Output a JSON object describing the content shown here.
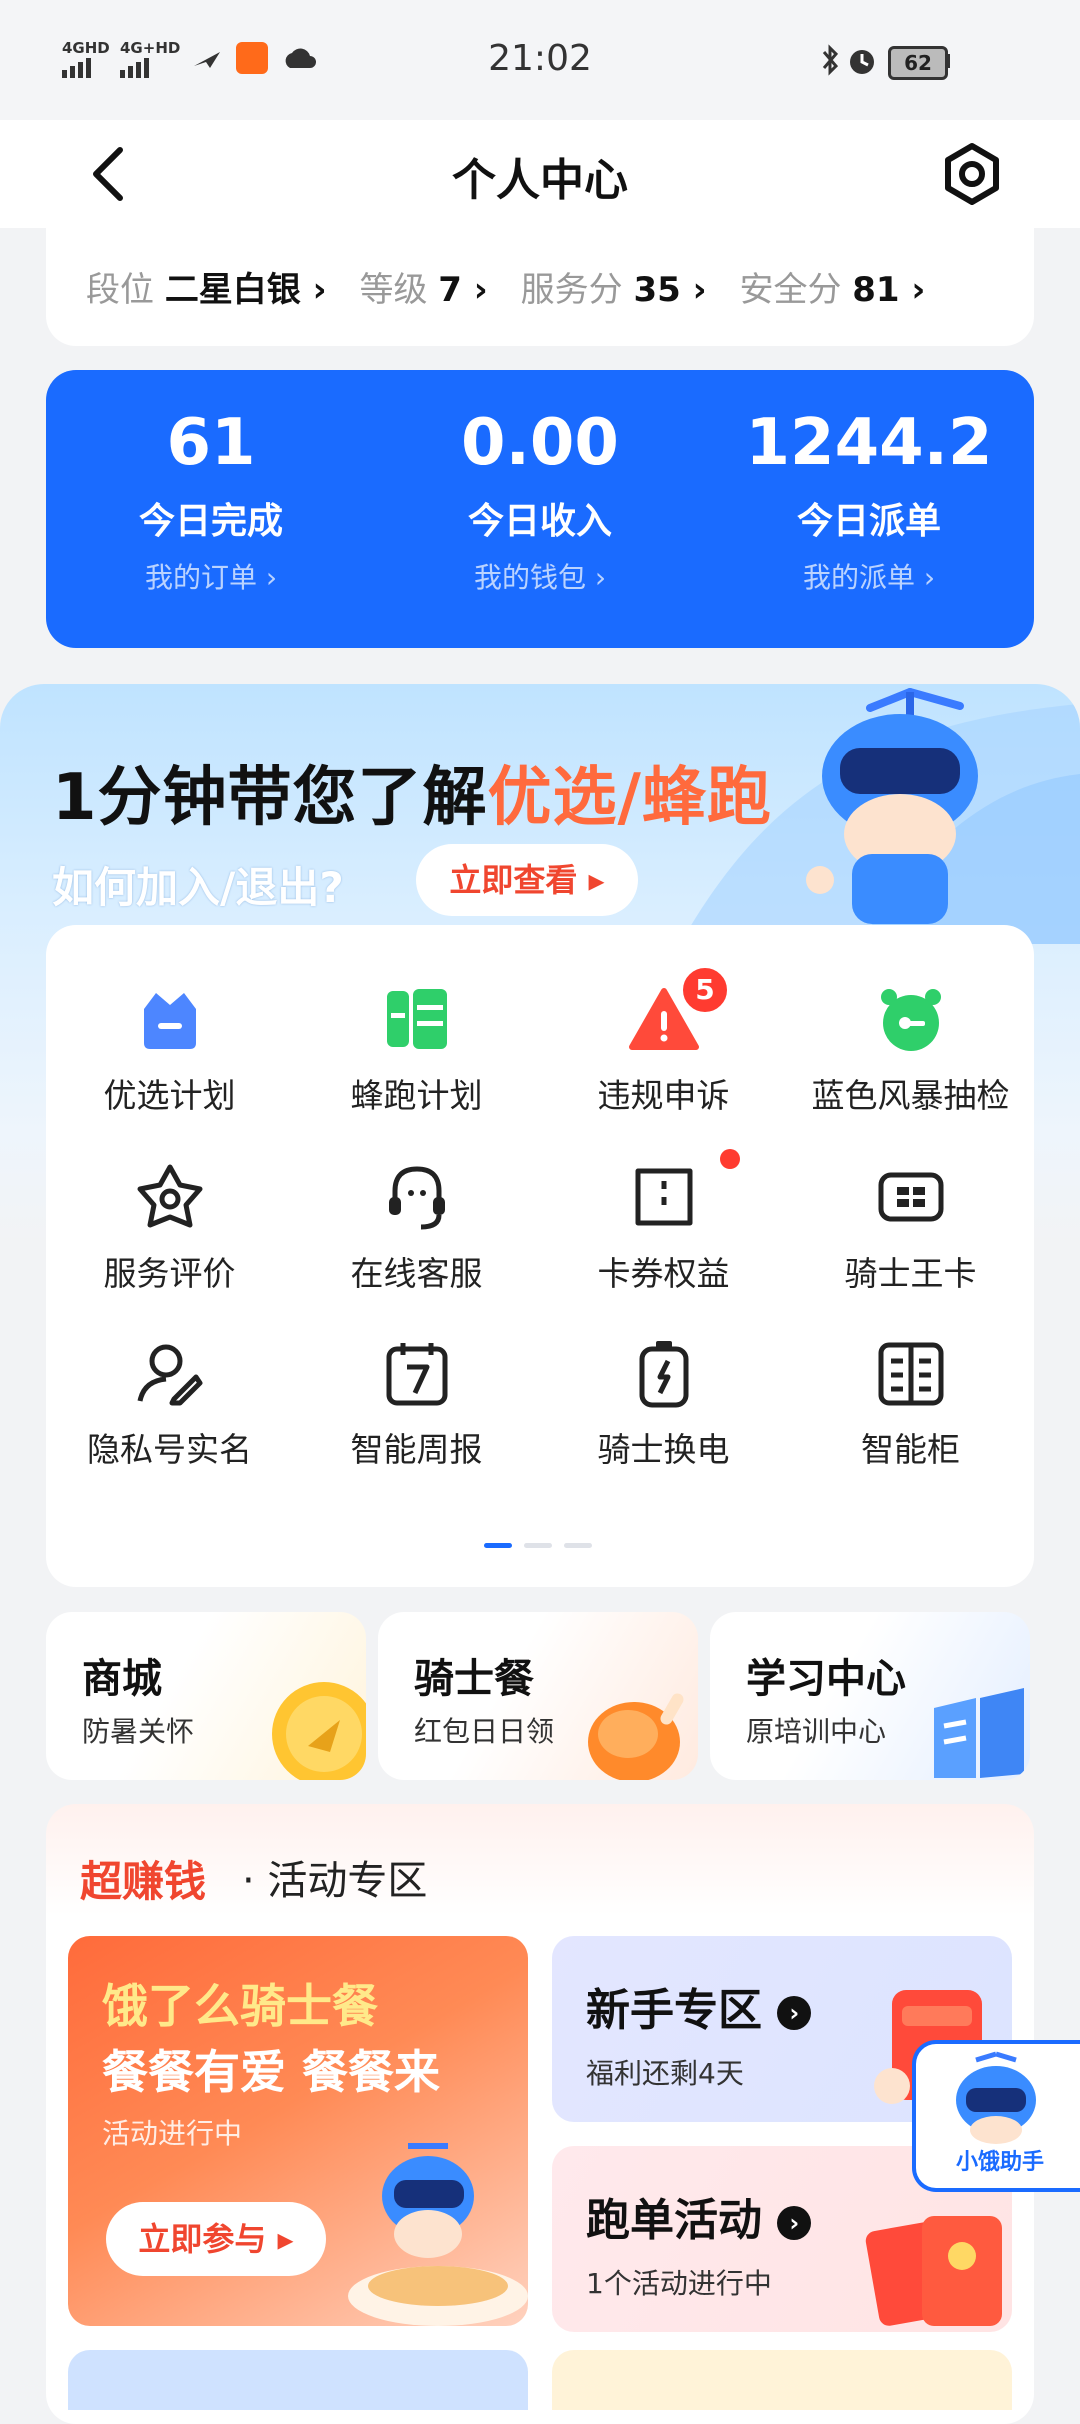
{
  "status_bar": {
    "time": "21:02",
    "signal1": "4GHD",
    "signal2": "4G+HD",
    "battery": "62"
  },
  "header": {
    "title": "个人中心"
  },
  "rank": {
    "items": [
      {
        "label": "段位",
        "value": "二星白银"
      },
      {
        "label": "等级",
        "value": "7"
      },
      {
        "label": "服务分",
        "value": "35"
      },
      {
        "label": "安全分",
        "value": "81"
      }
    ]
  },
  "stats": [
    {
      "value": "61",
      "label": "今日完成",
      "link": "我的订单 ›"
    },
    {
      "value": "0.00",
      "label": "今日收入",
      "link": "我的钱包 ›"
    },
    {
      "value": "1244.2",
      "label": "今日派单",
      "link": "我的派单 ›"
    }
  ],
  "banner": {
    "title_a": "1分钟带您了解",
    "title_b": "优选/蜂跑",
    "subtitle": "如何加入/退出?",
    "button": "立即查看 ▸"
  },
  "grid": [
    {
      "label": "优选计划",
      "icon": "crown-icon"
    },
    {
      "label": "蜂跑计划",
      "icon": "bee-character-icon"
    },
    {
      "label": "违规申诉",
      "icon": "warning-triangle-icon",
      "badge": "5"
    },
    {
      "label": "蓝色风暴抽检",
      "icon": "alarm-clock-icon"
    },
    {
      "label": "服务评价",
      "icon": "star-badge-icon"
    },
    {
      "label": "在线客服",
      "icon": "headset-icon"
    },
    {
      "label": "卡券权益",
      "icon": "coupon-icon"
    },
    {
      "label": "骑士王卡",
      "icon": "card-icon"
    },
    {
      "label": "隐私号实名",
      "icon": "user-edit-icon"
    },
    {
      "label": "智能周报",
      "icon": "calendar-icon"
    },
    {
      "label": "骑士换电",
      "icon": "battery-icon"
    },
    {
      "label": "智能柜",
      "icon": "cabinet-icon"
    }
  ],
  "tri_cards": [
    {
      "title": "商城",
      "sub": "防暑关怀"
    },
    {
      "title": "骑士餐",
      "sub": "红包日日领"
    },
    {
      "title": "学习中心",
      "sub": "原培训中心"
    }
  ],
  "activity": {
    "tag": "超赚钱",
    "title": "· 活动专区",
    "promo": {
      "line1": "饿了么骑士餐",
      "line2": "餐餐有爱 餐餐来",
      "status": "活动进行中",
      "button": "立即参与 ▸"
    },
    "cards": [
      {
        "title": "新手专区",
        "sub": "福利还剩4天"
      },
      {
        "title": "跑单活动",
        "sub": "1个活动进行中"
      }
    ]
  },
  "helper": {
    "label": "小饿助手"
  },
  "colors": {
    "primary": "#1a6bff",
    "accent": "#f0462f",
    "green": "#2fcf6a"
  }
}
